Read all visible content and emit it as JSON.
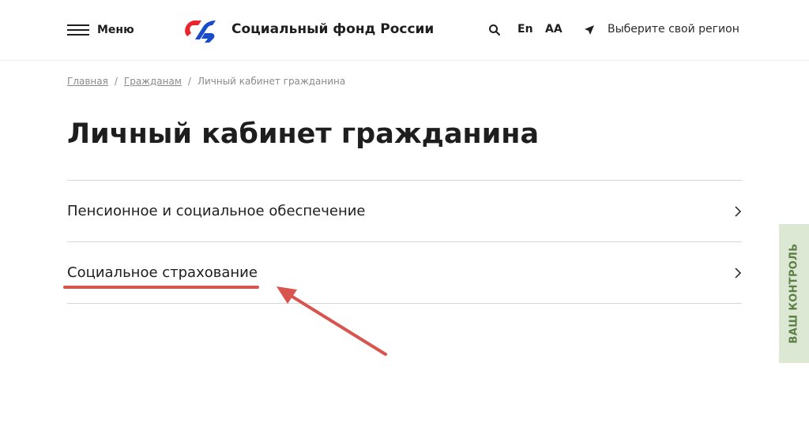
{
  "header": {
    "menu_label": "Меню",
    "org_name": "Социальный фонд России",
    "lang_label": "En",
    "font_size_label": "АА",
    "region_label": "Выберите свой регион"
  },
  "breadcrumb": {
    "items": [
      "Главная",
      "Гражданам",
      "Личный кабинет гражданина"
    ],
    "separator": "/"
  },
  "page": {
    "title": "Личный кабинет гражданина"
  },
  "list": {
    "items": [
      {
        "label": "Пенсионное и социальное обеспечение",
        "icon": "chevron-right-icon"
      },
      {
        "label": "Социальное страхование",
        "icon": "chevron-right-icon"
      }
    ]
  },
  "side_tab": {
    "label": "ВАШ КОНТРОЛЬ"
  },
  "colors": {
    "logo_red": "#e8262c",
    "logo_blue": "#1a4cc9",
    "annotation": "#d9534f",
    "side_tab_bg": "#dce8d3",
    "side_tab_text": "#5d7f45"
  }
}
